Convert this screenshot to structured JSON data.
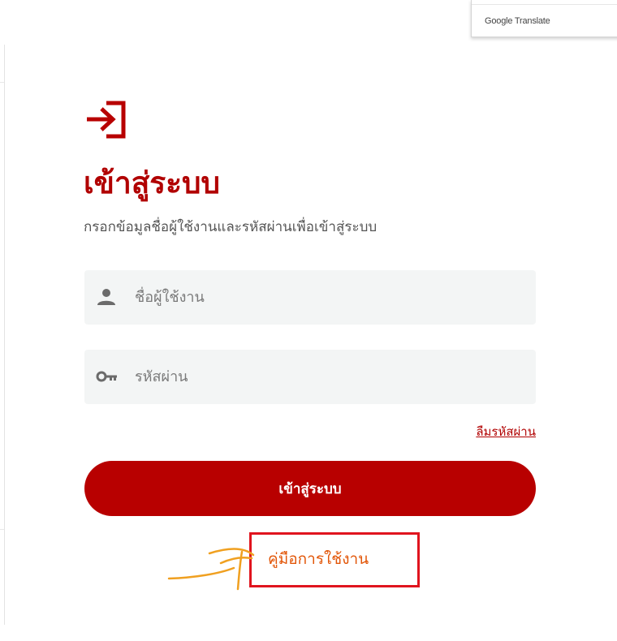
{
  "translate_popup": {
    "label": "Google Translate"
  },
  "login": {
    "title": "เข้าสู่ระบบ",
    "subtitle": "กรอกข้อมูลชื่อผู้ใช้งานและรหัสผ่านเพื่อเข้าสู่ระบบ",
    "username": {
      "placeholder": "ชื่อผู้ใช้งาน",
      "value": "",
      "icon": "user-icon"
    },
    "password": {
      "placeholder": "รหัสผ่าน",
      "value": "",
      "icon": "key-icon"
    },
    "forgot_password": "ลืมรหัสผ่าน",
    "submit_label": "เข้าสู่ระบบ",
    "manual_link": "คู่มือการใช้งาน"
  },
  "colors": {
    "brand_red": "#b80000",
    "field_bg": "#f3f5f5",
    "annotation_box": "#e0141e",
    "annotation_scribble": "#f0a020",
    "manual_text": "#e25507"
  },
  "icons": {
    "login": "login-arrow-icon",
    "annotation": "arrow-scribble-icon"
  }
}
